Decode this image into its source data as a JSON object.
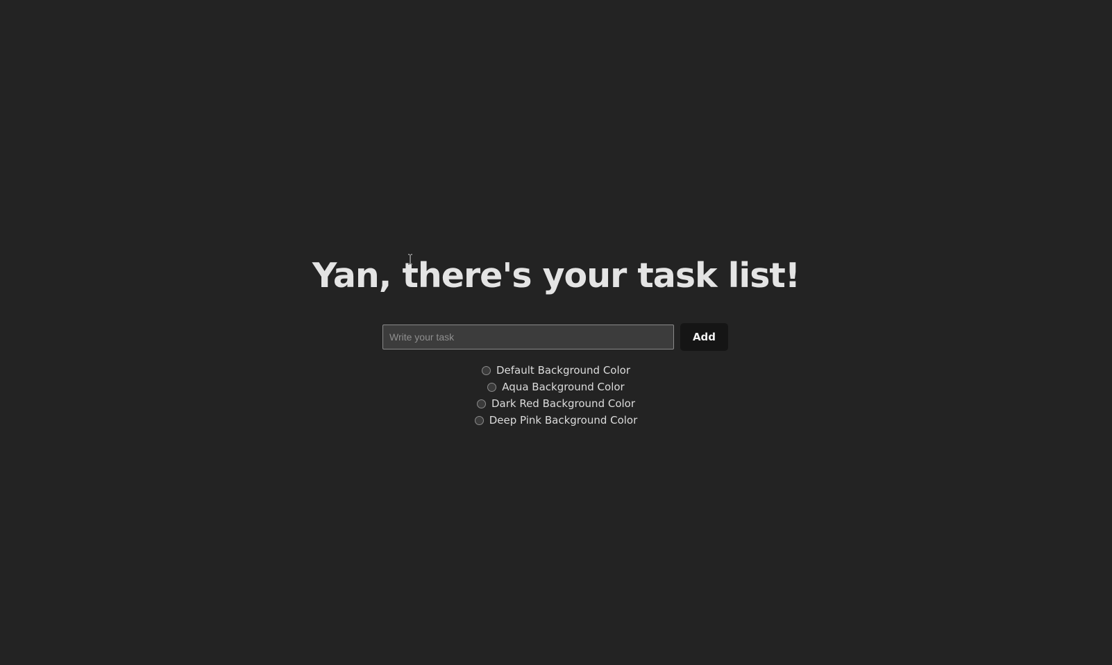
{
  "heading": "Yan, there's your task list!",
  "task_input": {
    "value": "",
    "placeholder": "Write your task"
  },
  "add_button_label": "Add",
  "color_options": [
    {
      "label": "Default Background Color",
      "selected": false
    },
    {
      "label": "Aqua Background Color",
      "selected": false
    },
    {
      "label": "Dark Red Background Color",
      "selected": false
    },
    {
      "label": "Deep Pink Background Color",
      "selected": false
    }
  ],
  "colors": {
    "background": "#232323",
    "heading": "#e4e4e4",
    "input_background": "#3c3c3c",
    "button_background": "#151515"
  },
  "icons": {
    "cursor": "text-cursor-icon"
  }
}
